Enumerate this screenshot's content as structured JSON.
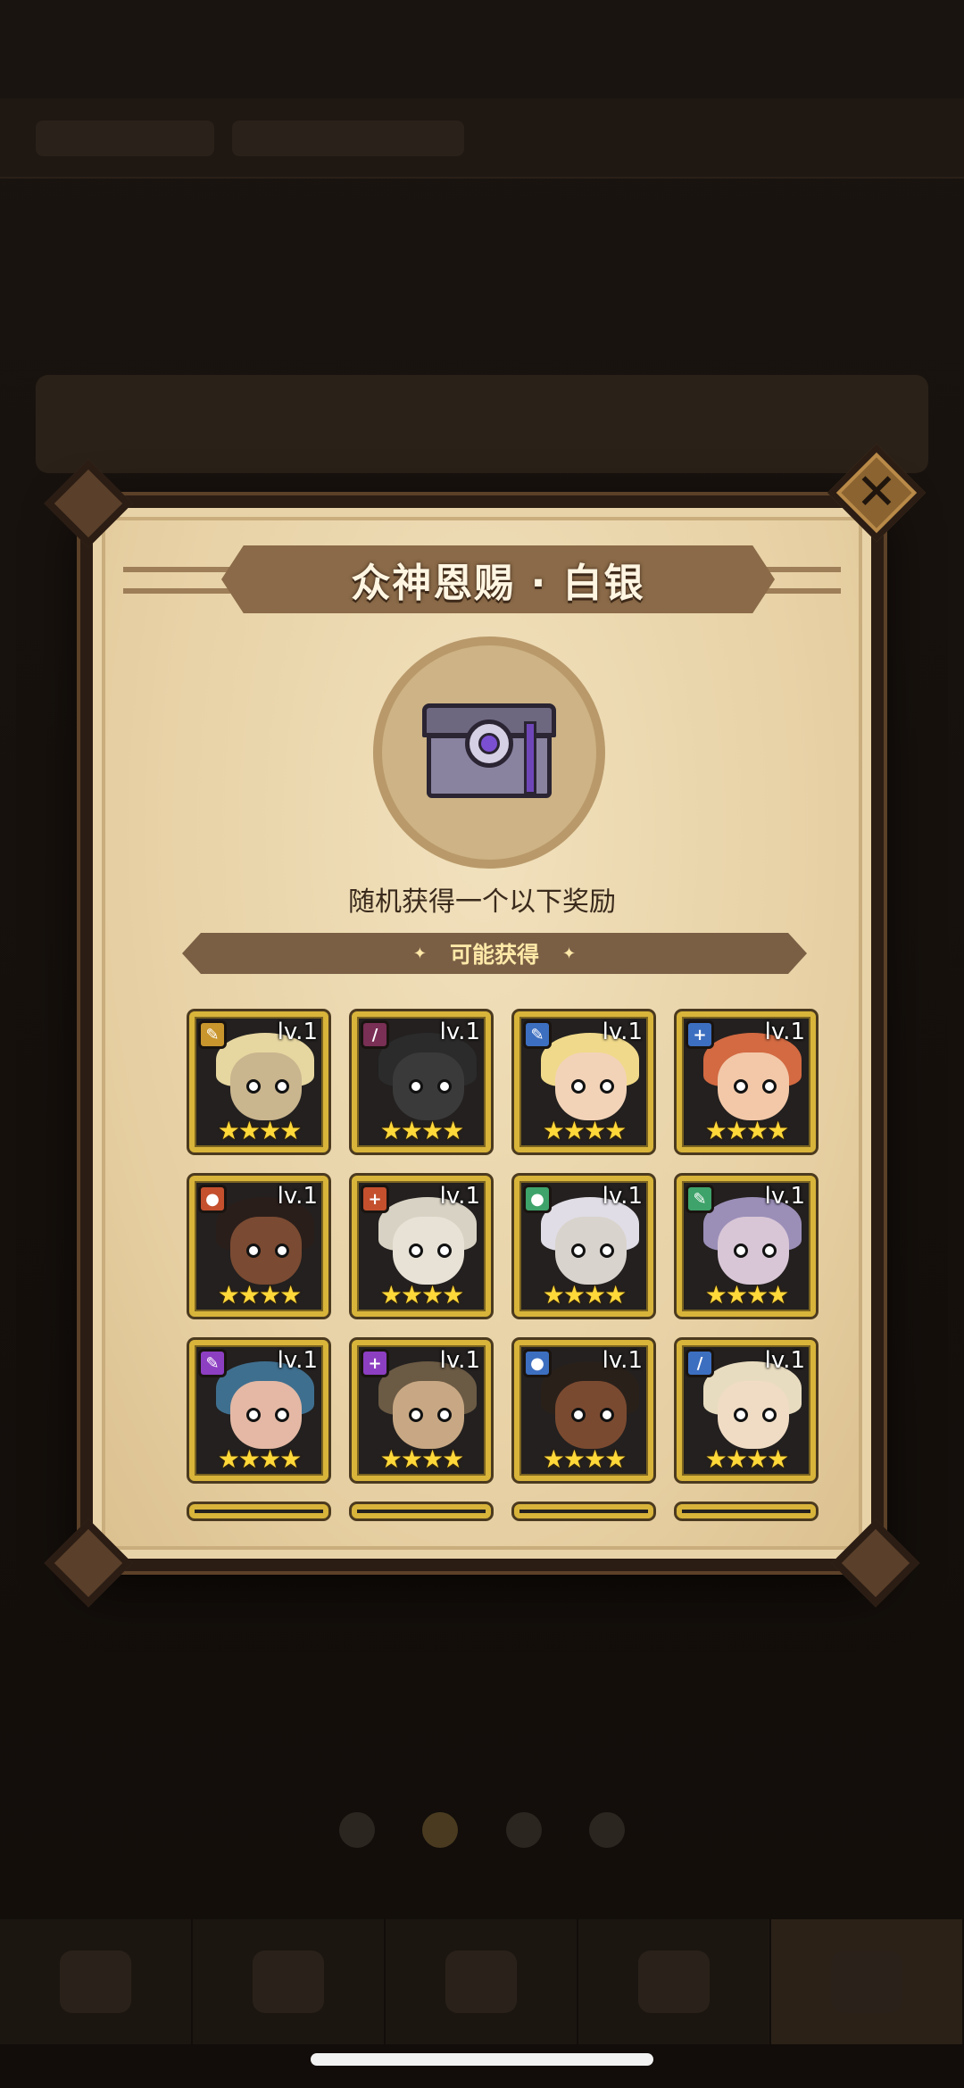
{
  "modal": {
    "title": "众神恩赐 · 白银",
    "description": "随机获得一个以下奖励",
    "section_label": "可能获得",
    "close_icon": "close-x-icon",
    "chest_icon": "silver-chest-icon"
  },
  "rewards": [
    {
      "level": "lv.1",
      "stars": "★★★★",
      "role_color": "#c9962e",
      "role_glyph": "✎",
      "hair": "#e6d6a0",
      "skin": "#c9b58e"
    },
    {
      "level": "lv.1",
      "stars": "★★★★",
      "role_color": "#7a2f55",
      "role_glyph": "/",
      "hair": "#2b2b2b",
      "skin": "#3a3a3a"
    },
    {
      "level": "lv.1",
      "stars": "★★★★",
      "role_color": "#3d6fc0",
      "role_glyph": "✎",
      "hair": "#f0d98a",
      "skin": "#f2d3b8"
    },
    {
      "level": "lv.1",
      "stars": "★★★★",
      "role_color": "#3d6fc0",
      "role_glyph": "+",
      "hair": "#d36a42",
      "skin": "#f2c8a8"
    },
    {
      "level": "lv.1",
      "stars": "★★★★",
      "role_color": "#c4502e",
      "role_glyph": "●",
      "hair": "#2a1e1a",
      "skin": "#7a4a32"
    },
    {
      "level": "lv.1",
      "stars": "★★★★",
      "role_color": "#c4502e",
      "role_glyph": "+",
      "hair": "#d8d2c4",
      "skin": "#e8e2d6"
    },
    {
      "level": "lv.1",
      "stars": "★★★★",
      "role_color": "#3ea36a",
      "role_glyph": "●",
      "hair": "#e0dde6",
      "skin": "#d9d3cd"
    },
    {
      "level": "lv.1",
      "stars": "★★★★",
      "role_color": "#3ea36a",
      "role_glyph": "✎",
      "hair": "#9b8fb8",
      "skin": "#d8c6d6"
    },
    {
      "level": "lv.1",
      "stars": "★★★★",
      "role_color": "#8d3fc2",
      "role_glyph": "✎",
      "hair": "#3f6f8f",
      "skin": "#e4b8a4"
    },
    {
      "level": "lv.1",
      "stars": "★★★★",
      "role_color": "#8d3fc2",
      "role_glyph": "+",
      "hair": "#6b5a44",
      "skin": "#c8a884"
    },
    {
      "level": "lv.1",
      "stars": "★★★★",
      "role_color": "#3d6fc0",
      "role_glyph": "●",
      "hair": "#2a201a",
      "skin": "#7a4a30"
    },
    {
      "level": "lv.1",
      "stars": "★★★★",
      "role_color": "#3d6fc0",
      "role_glyph": "/",
      "hair": "#e8dcc0",
      "skin": "#f0dcc4"
    }
  ]
}
